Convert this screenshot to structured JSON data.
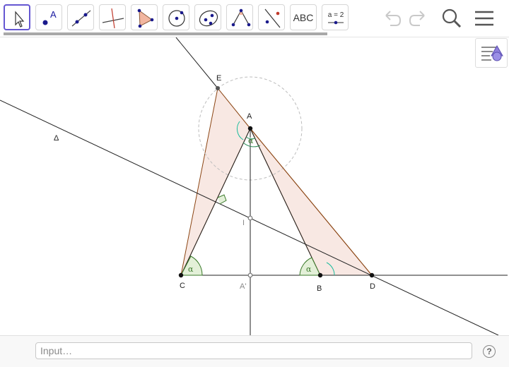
{
  "toolbar": {
    "tools": [
      {
        "name": "move-tool",
        "label": ""
      },
      {
        "name": "point-tool",
        "label": "A"
      },
      {
        "name": "line-tool",
        "label": ""
      },
      {
        "name": "perpendicular-line-tool",
        "label": ""
      },
      {
        "name": "polygon-tool",
        "label": ""
      },
      {
        "name": "circle-center-point-tool",
        "label": ""
      },
      {
        "name": "conic-tool",
        "label": ""
      },
      {
        "name": "angle-tool",
        "label": ""
      },
      {
        "name": "reflect-tool",
        "label": ""
      },
      {
        "name": "text-tool",
        "label": "ABC"
      },
      {
        "name": "slider-tool",
        "label": "a = 2"
      }
    ],
    "undo_icon": "undo-icon",
    "redo_icon": "redo-icon",
    "search_icon": "search-icon",
    "menu_icon": "menu-icon"
  },
  "style_bar": {
    "icon": "style-bar-icon"
  },
  "graphics": {
    "points": {
      "A": "A",
      "B": "B",
      "C": "C",
      "D": "D",
      "E": "E",
      "I": "I",
      "A_prime": "A'"
    },
    "line_label": "Δ",
    "angle_label": "α"
  },
  "input_bar": {
    "placeholder": "Input…",
    "help_label": "?"
  }
}
